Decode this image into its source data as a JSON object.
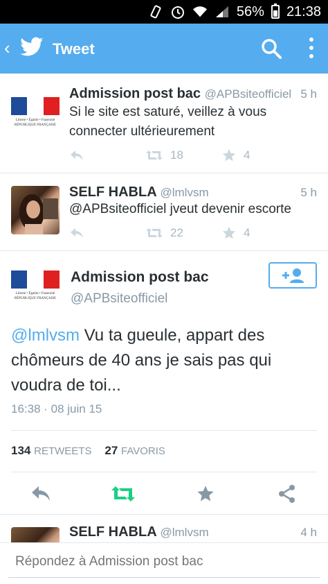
{
  "status_bar": {
    "battery": "56%",
    "time": "21:38"
  },
  "app_bar": {
    "title": "Tweet"
  },
  "tweets": [
    {
      "name": "Admission post bac",
      "handle": "@APBsiteofficiel",
      "time": "5 h",
      "text": "Si le site est saturé, veillez à vous connecter ultérieurement",
      "retweets": "18",
      "favorites": "4"
    },
    {
      "name": "SELF HABLA",
      "handle": "@lmlvsm",
      "time": "5 h",
      "text": "@APBsiteofficiel jveut devenir escorte",
      "retweets": "22",
      "favorites": "4"
    }
  ],
  "logo": {
    "line1": "Liberté • Égalité • Fraternité",
    "line2": "RÉPUBLIQUE FRANÇAISE"
  },
  "main_tweet": {
    "name": "Admission post bac",
    "handle": "@APBsiteofficiel",
    "mention": "@lmlvsm",
    "text": " Vu ta gueule, appart des chômeurs de 40 ans je sais pas qui voudra de toi...",
    "date": "16:38 · 08 juin 15",
    "retweets_count": "134",
    "retweets_label": "RETWEETS",
    "favorites_count": "27",
    "favorites_label": "FAVORIS"
  },
  "reply_preview": {
    "name": "SELF HABLA",
    "handle": "@lmlvsm",
    "time": "4 h"
  },
  "reply_box": {
    "placeholder": "Répondez à Admission post bac"
  },
  "colors": {
    "accent": "#55acee",
    "retweet_active": "#19cf86",
    "muted": "#8899a6"
  }
}
